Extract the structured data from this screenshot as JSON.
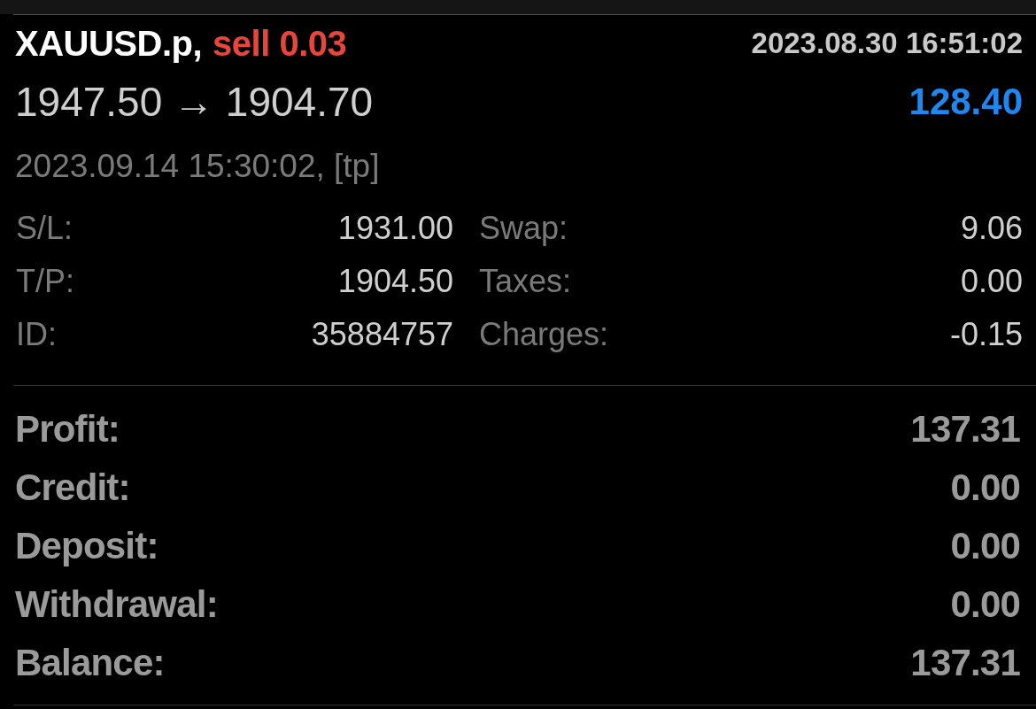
{
  "deal": {
    "symbol": "XAUUSD.p,",
    "order": "sell 0.03",
    "kind": "sell",
    "open_time": "2023.08.30 16:51:02",
    "prices": "1947.50 → 1904.70",
    "result": "128.40",
    "close_info": "2023.09.14 15:30:02, [tp]"
  },
  "details": [
    {
      "label": "S/L:",
      "value": "1931.00"
    },
    {
      "label": "Swap:",
      "value": "9.06"
    },
    {
      "label": "T/P:",
      "value": "1904.50"
    },
    {
      "label": "Taxes:",
      "value": "0.00"
    },
    {
      "label": "ID:",
      "value": "35884757"
    },
    {
      "label": "Charges:",
      "value": "-0.15"
    }
  ],
  "summary": [
    {
      "label": "Profit:",
      "value": "137.31"
    },
    {
      "label": "Credit:",
      "value": "0.00"
    },
    {
      "label": "Deposit:",
      "value": "0.00"
    },
    {
      "label": "Withdrawal:",
      "value": "0.00"
    },
    {
      "label": "Balance:",
      "value": "137.31"
    }
  ]
}
